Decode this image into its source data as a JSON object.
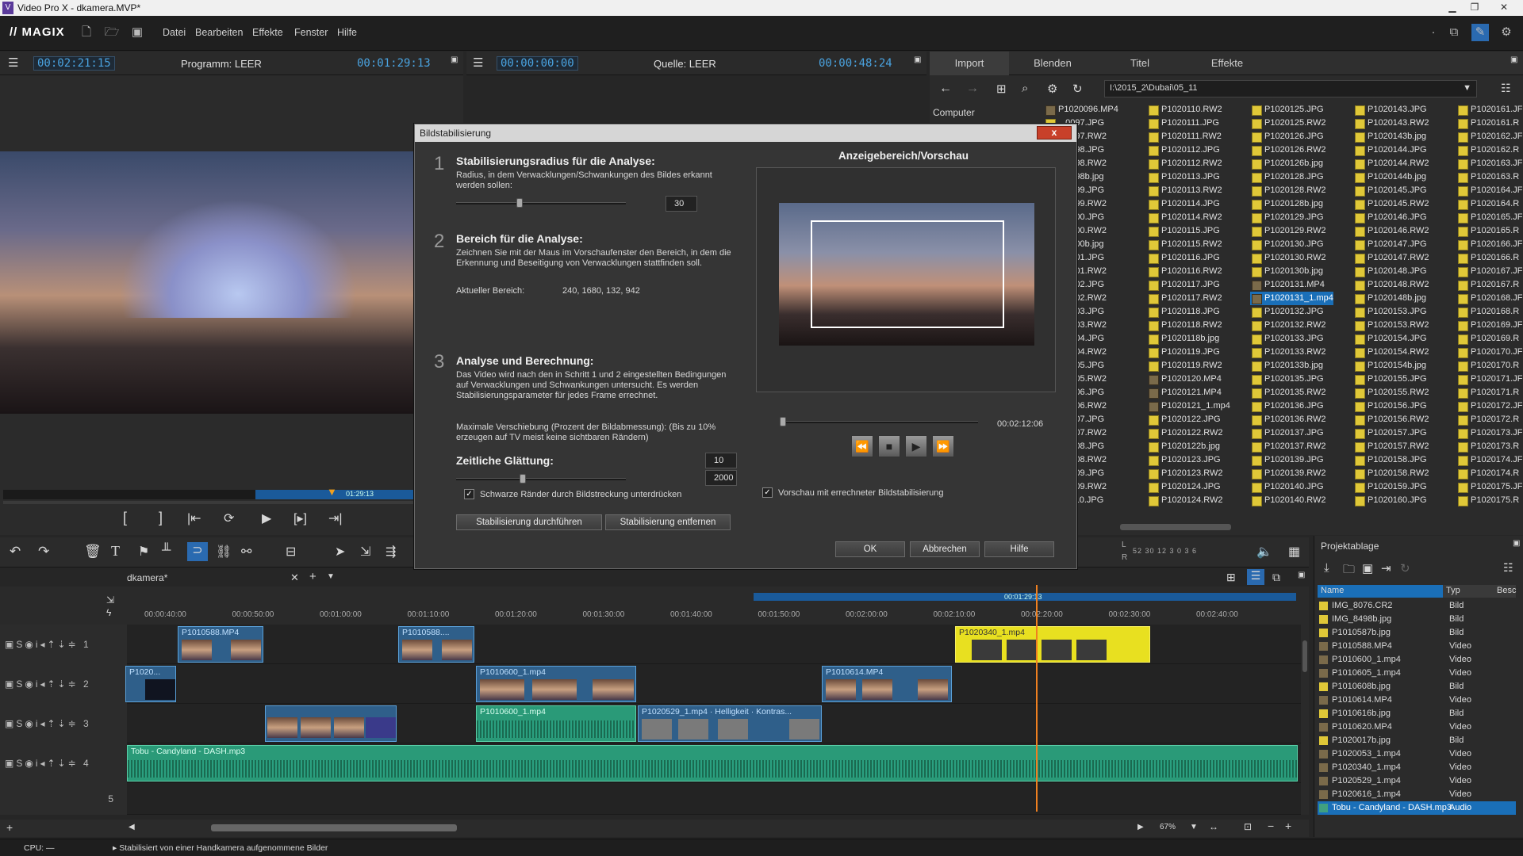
{
  "window": {
    "title": "Video Pro X - dkamera.MVP*"
  },
  "menu": {
    "brand": "// MAGIX",
    "items": [
      "Datei",
      "Bearbeiten",
      "Effekte",
      "Fenster",
      "Hilfe"
    ]
  },
  "program": {
    "timecode_left": "00:02:21:15",
    "label": "Programm: LEER",
    "timecode_right": "00:01:29:13",
    "scrub_tc": "01:29:13"
  },
  "source": {
    "timecode_left": "00:00:00:00",
    "label": "Quelle: LEER",
    "timecode_right": "00:00:48:24"
  },
  "media": {
    "tabs": [
      "Import",
      "Blenden",
      "Titel",
      "Effekte"
    ],
    "path": "I:\\2015_2\\Dubai\\05_11",
    "computer_label": "Computer",
    "col0": [
      "P1020096.MP4",
      "...0097.JPG",
      "...0097.RW2",
      "...0098.JPG",
      "...0098.RW2",
      "...0098b.jpg",
      "...0099.JPG",
      "...0099.RW2",
      "...0100.JPG",
      "...0100.RW2",
      "...0100b.jpg",
      "...0101.JPG",
      "...0101.RW2",
      "...0102.JPG",
      "...0102.RW2",
      "...0103.JPG",
      "...0103.RW2",
      "...0104.JPG",
      "...0104.RW2",
      "...0105.JPG",
      "...0105.RW2",
      "...0106.JPG",
      "...0106.RW2",
      "...0107.JPG",
      "...0107.RW2",
      "...0108.JPG",
      "...0108.RW2",
      "...0109.JPG",
      "...0109.RW2",
      "...0110.JPG"
    ],
    "col1": [
      "P1020110.RW2",
      "P1020111.JPG",
      "P1020111.RW2",
      "P1020112.JPG",
      "P1020112.RW2",
      "P1020113.JPG",
      "P1020113.RW2",
      "P1020114.JPG",
      "P1020114.RW2",
      "P1020115.JPG",
      "P1020115.RW2",
      "P1020116.JPG",
      "P1020116.RW2",
      "P1020117.JPG",
      "P1020117.RW2",
      "P1020118.JPG",
      "P1020118.RW2",
      "P1020118b.jpg",
      "P1020119.JPG",
      "P1020119.RW2",
      "P1020120.MP4",
      "P1020121.MP4",
      "P1020121_1.mp4",
      "P1020122.JPG",
      "P1020122.RW2",
      "P1020122b.jpg",
      "P1020123.JPG",
      "P1020123.RW2",
      "P1020124.JPG",
      "P1020124.RW2"
    ],
    "col2": [
      "P1020125.JPG",
      "P1020125.RW2",
      "P1020126.JPG",
      "P1020126.RW2",
      "P1020126b.jpg",
      "P1020128.JPG",
      "P1020128.RW2",
      "P1020128b.jpg",
      "P1020129.JPG",
      "P1020129.RW2",
      "P1020130.JPG",
      "P1020130.RW2",
      "P1020130b.jpg",
      "P1020131.MP4",
      "P1020131_1.mp4",
      "P1020132.JPG",
      "P1020132.RW2",
      "P1020133.JPG",
      "P1020133.RW2",
      "P1020133b.jpg",
      "P1020135.JPG",
      "P1020135.RW2",
      "P1020136.JPG",
      "P1020136.RW2",
      "P1020137.JPG",
      "P1020137.RW2",
      "P1020139.JPG",
      "P1020139.RW2",
      "P1020140.JPG",
      "P1020140.RW2"
    ],
    "col3": [
      "P1020143.JPG",
      "P1020143.RW2",
      "P1020143b.jpg",
      "P1020144.JPG",
      "P1020144.RW2",
      "P1020144b.jpg",
      "P1020145.JPG",
      "P1020145.RW2",
      "P1020146.JPG",
      "P1020146.RW2",
      "P1020147.JPG",
      "P1020147.RW2",
      "P1020148.JPG",
      "P1020148.RW2",
      "P1020148b.jpg",
      "P1020153.JPG",
      "P1020153.RW2",
      "P1020154.JPG",
      "P1020154.RW2",
      "P1020154b.jpg",
      "P1020155.JPG",
      "P1020155.RW2",
      "P1020156.JPG",
      "P1020156.RW2",
      "P1020157.JPG",
      "P1020157.RW2",
      "P1020158.JPG",
      "P1020158.RW2",
      "P1020159.JPG",
      "P1020160.JPG"
    ],
    "col4": [
      "P1020161.JF",
      "P1020161.R",
      "P1020162.JF",
      "P1020162.R",
      "P1020163.JF",
      "P1020163.R",
      "P1020164.JF",
      "P1020164.R",
      "P1020165.JF",
      "P1020165.R",
      "P1020166.JF",
      "P1020166.R",
      "P1020167.JF",
      "P1020167.R",
      "P1020168.JF",
      "P1020168.R",
      "P1020169.JF",
      "P1020169.R",
      "P1020170.JF",
      "P1020170.R",
      "P1020171.JF",
      "P1020171.R",
      "P1020172.JF",
      "P1020172.R",
      "P1020173.JF",
      "P1020173.R",
      "P1020174.JF",
      "P1020174.R",
      "P1020175.JF",
      "P1020175.R"
    ]
  },
  "dialog": {
    "title": "Bildstabilisierung",
    "close": "x",
    "step1": {
      "num": "1",
      "title": "Stabilisierungsradius für die Analyse:",
      "text": "Radius, in dem Verwacklungen/Schwankungen des Bildes erkannt werden sollen:",
      "value": "30"
    },
    "step2": {
      "num": "2",
      "title": "Bereich für die Analyse:",
      "text": "Zeichnen Sie mit der Maus im Vorschaufenster den Bereich, in dem die Erkennung und Beseitigung von Verwacklungen stattfinden soll.",
      "area_label": "Aktueller Bereich:",
      "area_value": "240, 1680, 132, 942"
    },
    "step3": {
      "num": "3",
      "title": "Analyse und Berechnung:",
      "text": "Das Video wird nach den in Schritt 1 und 2 eingestellten Bedingungen auf Verwacklungen und Schwankungen untersucht. Es werden Stabilisierungsparameter für jedes Frame errechnet.",
      "shift_text": "Maximale Verschiebung (Prozent der Bildabmessung): (Bis zu 10% erzeugen auf TV meist keine sichtbaren Rändern)",
      "shift_value": "10"
    },
    "smooth": {
      "title": "Zeitliche Glättung:",
      "value": "2000"
    },
    "checkbox_black": "Schwarze Ränder durch Bildstreckung unterdrücken",
    "btn_run": "Stabilisierung durchführen",
    "btn_remove": "Stabilisierung entfernen",
    "preview_title": "Anzeigebereich/Vorschau",
    "preview_tc": "00:02:12:06",
    "checkbox_preview": "Vorschau mit errechneter Bildstabilisierung",
    "ok": "OK",
    "cancel": "Abbrechen",
    "help": "Hilfe"
  },
  "timeline": {
    "project_tab": "dkamera*",
    "marker_tc": "00:01:29:13",
    "ruler": [
      "00:00:40:00",
      "00:00:50:00",
      "00:01:00:00",
      "00:01:10:00",
      "00:01:20:00",
      "00:01:30:00",
      "00:01:40:00",
      "00:01:50:00",
      "00:02:00:00",
      "00:02:10:00",
      "00:02:20:00",
      "00:02:30:00",
      "00:02:40:00"
    ],
    "tracks": [
      "1",
      "2",
      "3",
      "4",
      "5"
    ],
    "clips": {
      "c1a": "P1010588.MP4",
      "c1b": "P1010588....",
      "c1c": "P1020340_1.mp4",
      "c2a": "P1020...",
      "c2b": "P1010600_1.mp4",
      "c2c": "P1010614.MP4",
      "c3a": "P1010600_1.mp4",
      "c3b": "P1020529_1.mp4 · Helligkeit · Kontras...",
      "c4": "Tobu - Candyland - DASH.mp3"
    },
    "zoom": "67%",
    "meter": "52  30  12    3  0  3  6"
  },
  "projektablage": {
    "title": "Projektablage",
    "col_name": "Name",
    "col_type": "Typ",
    "col_desc": "Besc",
    "rows": [
      [
        "IMG_8076.CR2",
        "Bild"
      ],
      [
        "IMG_8498b.jpg",
        "Bild"
      ],
      [
        "P1010587b.jpg",
        "Bild"
      ],
      [
        "P1010588.MP4",
        "Video"
      ],
      [
        "P1010600_1.mp4",
        "Video"
      ],
      [
        "P1010605_1.mp4",
        "Video"
      ],
      [
        "P1010608b.jpg",
        "Bild"
      ],
      [
        "P1010614.MP4",
        "Video"
      ],
      [
        "P1010616b.jpg",
        "Bild"
      ],
      [
        "P1010620.MP4",
        "Video"
      ],
      [
        "P1020017b.jpg",
        "Bild"
      ],
      [
        "P1020053_1.mp4",
        "Video"
      ],
      [
        "P1020340_1.mp4",
        "Video"
      ],
      [
        "P1020529_1.mp4",
        "Video"
      ],
      [
        "P1020616_1.mp4",
        "Video"
      ],
      [
        "Tobu - Candyland - DASH.mp3",
        "Audio"
      ]
    ]
  },
  "status": {
    "cpu": "CPU: —",
    "message": "Stabilisiert von einer Handkamera aufgenommene Bilder"
  }
}
